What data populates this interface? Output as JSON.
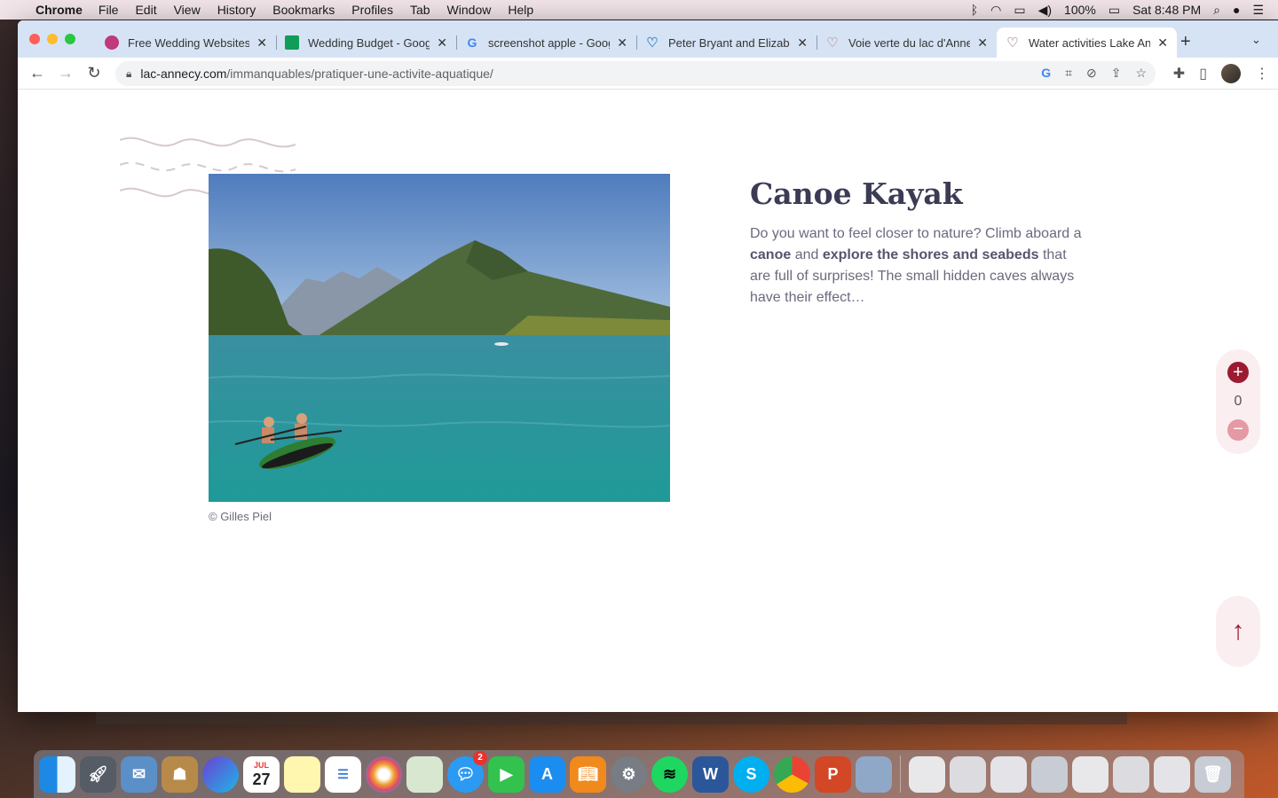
{
  "menubar": {
    "app_name": "Chrome",
    "items": [
      "File",
      "Edit",
      "View",
      "History",
      "Bookmarks",
      "Profiles",
      "Tab",
      "Window",
      "Help"
    ],
    "battery": "100%",
    "clock": "Sat 8:48 PM"
  },
  "tabs": [
    {
      "title": "Free Wedding Websites",
      "favicon": "zola-icon",
      "color": "#c0397a",
      "active": false
    },
    {
      "title": "Wedding Budget - Goog",
      "favicon": "sheets-icon",
      "color": "#0f9d58",
      "active": false
    },
    {
      "title": "screenshot apple - Goog",
      "favicon": "google-icon",
      "color": "#4285f4",
      "active": false
    },
    {
      "title": "Peter Bryant and Elizabe",
      "favicon": "heart-icon",
      "color": "#4a90c8",
      "active": false
    },
    {
      "title": "Voie verte du lac d'Anne",
      "favicon": "heart-icon",
      "color": "#c8b4b8",
      "active": false
    },
    {
      "title": "Water activities Lake An",
      "favicon": "heart-icon",
      "color": "#c8b4b8",
      "active": true
    }
  ],
  "address_bar": {
    "host": "lac-annecy.com",
    "path": "/immanquables/pratiquer-une-activite-aquatique/"
  },
  "page": {
    "photo_credit": "© Gilles Piel",
    "title": "Canoe Kayak",
    "text_1": "Do you want to feel closer to nature? Climb aboard a ",
    "bold_1": "canoe",
    "text_2": " and ",
    "bold_2": "explore the shores and seabeds",
    "text_3": " that are full of surprises! The small hidden caves always have their effect…",
    "counter_value": "0",
    "accent_color": "#9b1b30"
  },
  "dock": {
    "messages_badge": "2",
    "calendar_month": "JUL",
    "calendar_day": "27"
  }
}
